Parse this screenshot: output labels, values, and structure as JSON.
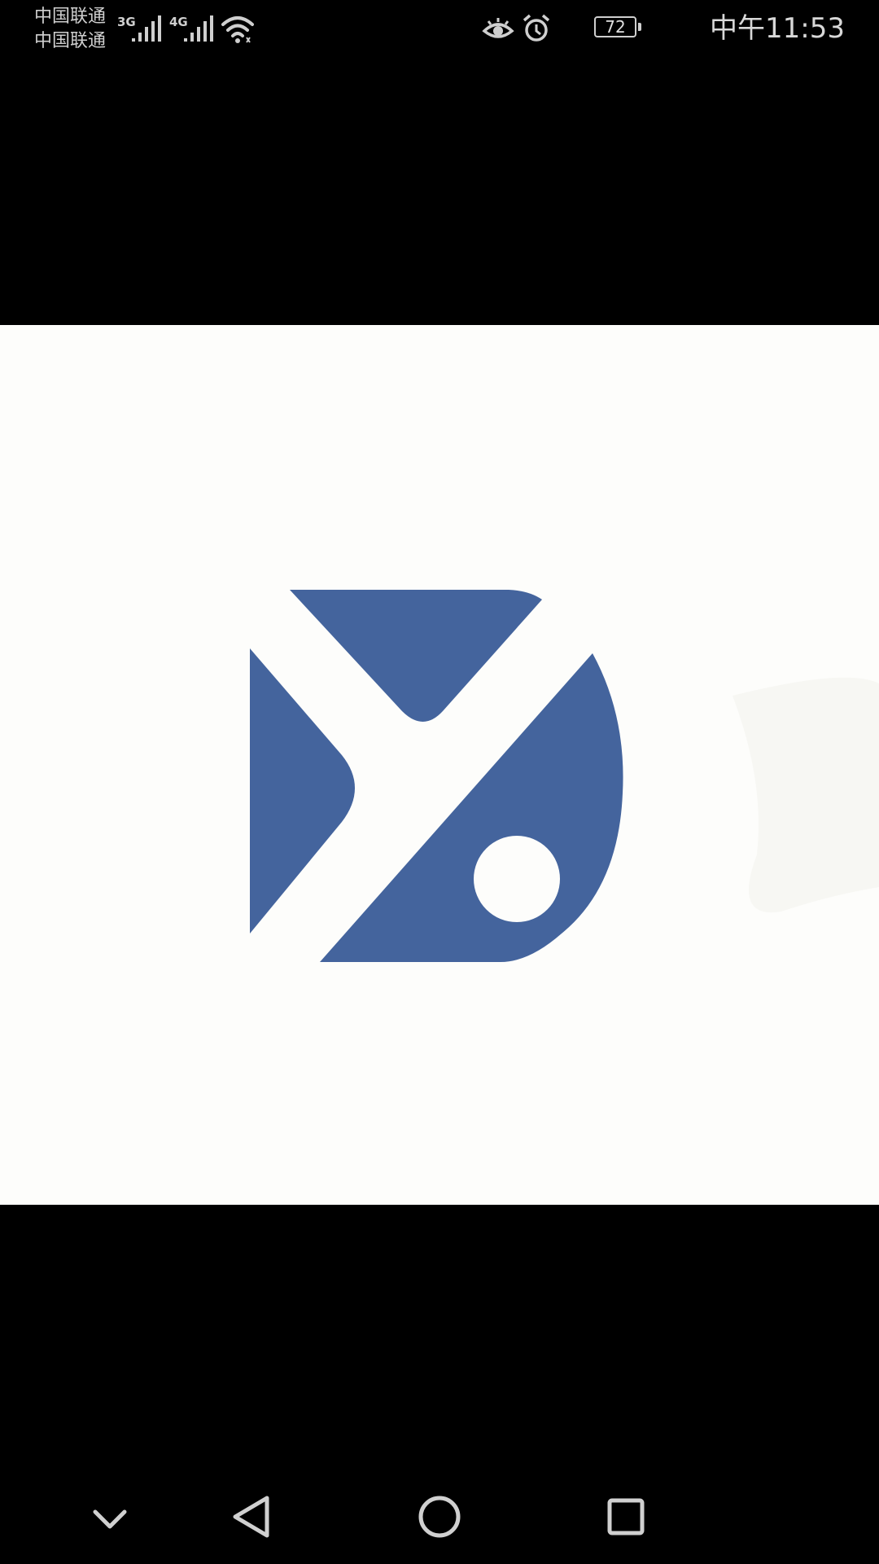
{
  "status_bar": {
    "carrier_1": "中国联通",
    "carrier_2": "中国联通",
    "network_1": "3G",
    "network_2": "4G",
    "battery": "72",
    "time": "中午11:53",
    "icons": [
      "signal-3g-icon",
      "signal-4g-icon",
      "wifi-icon",
      "eye-icon",
      "alarm-icon",
      "battery-icon"
    ]
  },
  "image_view": {
    "logo_color": "#44649d",
    "background": "#fdfdfb"
  },
  "nav_bar": {
    "icons": [
      "collapse-chevron-icon",
      "back-icon",
      "home-icon",
      "recents-icon"
    ]
  }
}
